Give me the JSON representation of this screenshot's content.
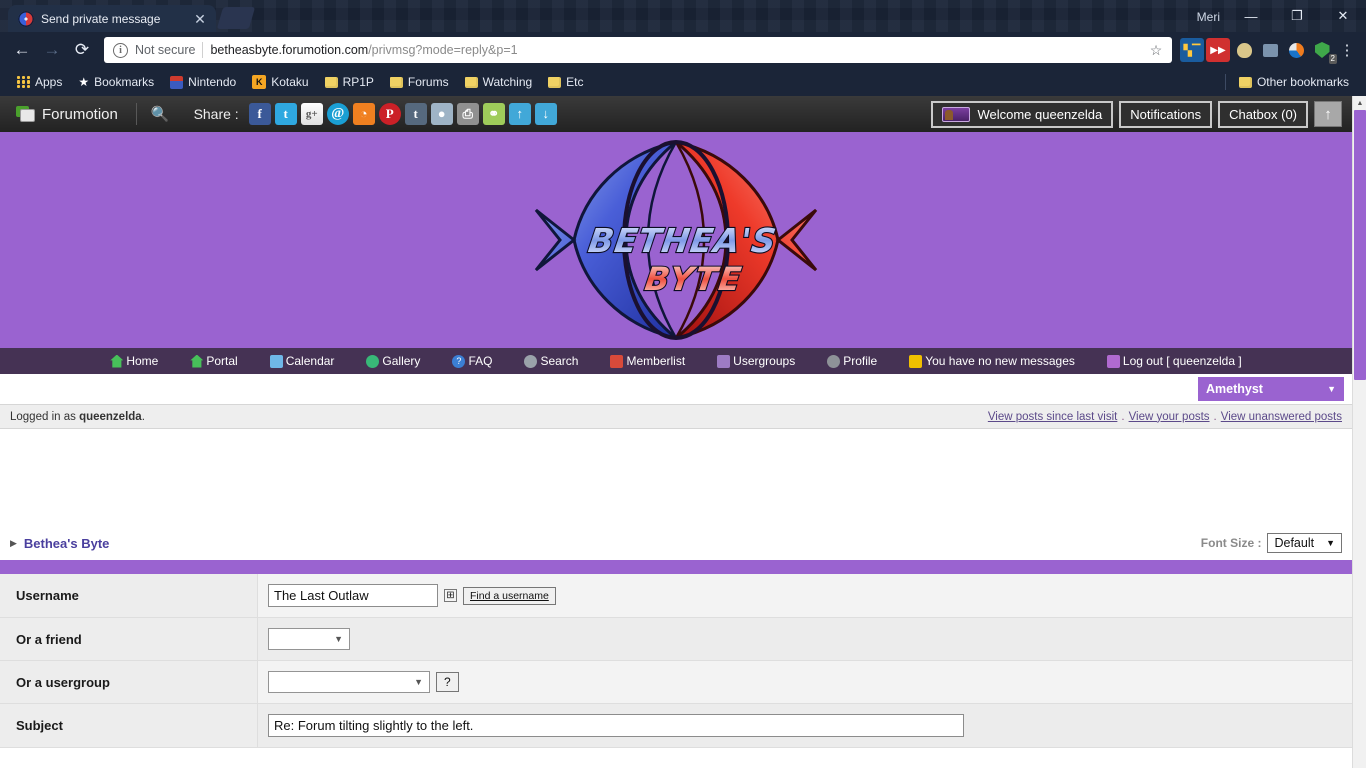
{
  "browser": {
    "tab_title": "Send private message",
    "tab_close": "✕",
    "profile_name": "Meri",
    "minimize": "—",
    "maximize": "❐",
    "close": "✕",
    "back": "←",
    "forward": "→",
    "reload": "⟳",
    "security_label": "Not secure",
    "url_domain": "betheasbyte.forumotion.com",
    "url_path": "/privmsg?mode=reply&p=1",
    "star": "☆",
    "menu": "⋮",
    "extension_badge": "2",
    "bookmarks": [
      {
        "label": "Apps",
        "icon": "apps-grid-icon"
      },
      {
        "label": "Bookmarks",
        "icon": "star-icon"
      },
      {
        "label": "Nintendo",
        "icon": "mario-icon"
      },
      {
        "label": "Kotaku",
        "icon": "kotaku-icon"
      },
      {
        "label": "RP1P",
        "icon": "folder-icon"
      },
      {
        "label": "Forums",
        "icon": "folder-icon"
      },
      {
        "label": "Watching",
        "icon": "folder-icon"
      },
      {
        "label": "Etc",
        "icon": "folder-icon"
      }
    ],
    "other_bookmarks": "Other bookmarks"
  },
  "forumotion_bar": {
    "brand": "Forumotion",
    "search_icon": "search-icon",
    "share_label": "Share :",
    "share_icons": [
      {
        "name": "facebook-icon",
        "glyph": "f"
      },
      {
        "name": "twitter-icon",
        "glyph": "t"
      },
      {
        "name": "googleplus-icon",
        "glyph": "g+"
      },
      {
        "name": "email-icon",
        "glyph": "@"
      },
      {
        "name": "rss-icon",
        "glyph": "◔"
      },
      {
        "name": "pinterest-icon",
        "glyph": "P"
      },
      {
        "name": "tumblr-icon",
        "glyph": "t"
      },
      {
        "name": "reddit-icon",
        "glyph": "●"
      },
      {
        "name": "print-icon",
        "glyph": "⎙"
      },
      {
        "name": "link-icon",
        "glyph": "⚭"
      },
      {
        "name": "arrow-up-icon",
        "glyph": "↑"
      },
      {
        "name": "arrow-down-icon",
        "glyph": "↓"
      }
    ],
    "welcome": "Welcome queenzelda",
    "notifications": "Notifications",
    "chatbox": "Chatbox (0)",
    "scroll_top_icon": "↑"
  },
  "banner": {
    "logo_line1": "BETHEA'S",
    "logo_line2": "BYTE",
    "background_color": "#9a63d0"
  },
  "forum_nav": [
    {
      "label": "Home",
      "icon": "home-icon",
      "cls": "i-home"
    },
    {
      "label": "Portal",
      "icon": "portal-icon",
      "cls": "i-home"
    },
    {
      "label": "Calendar",
      "icon": "calendar-icon",
      "cls": "i-cal"
    },
    {
      "label": "Gallery",
      "icon": "gallery-icon",
      "cls": "i-gal"
    },
    {
      "label": "FAQ",
      "icon": "faq-icon",
      "cls": "i-faq"
    },
    {
      "label": "Search",
      "icon": "search-icon",
      "cls": "i-sea"
    },
    {
      "label": "Memberlist",
      "icon": "memberlist-icon",
      "cls": "i-mem"
    },
    {
      "label": "Usergroups",
      "icon": "usergroups-icon",
      "cls": "i-usg"
    },
    {
      "label": "Profile",
      "icon": "profile-icon",
      "cls": "i-pro"
    },
    {
      "label": "You have no new messages",
      "icon": "envelope-icon",
      "cls": "i-msg"
    },
    {
      "label": "Log out [ queenzelda ]",
      "icon": "logout-icon",
      "cls": "i-out"
    }
  ],
  "theme": {
    "selected": "Amethyst",
    "caret": "▼"
  },
  "login_strip": {
    "prefix": "Logged in as ",
    "username": "queenzelda",
    "suffix": ".",
    "links": [
      "View posts since last visit",
      "View your posts",
      "View unanswered posts"
    ],
    "separator": "."
  },
  "breadcrumb": {
    "arrow": "▶",
    "label": "Bethea's Byte"
  },
  "font_size": {
    "label": "Font Size :",
    "selected": "Default",
    "caret": "▼"
  },
  "form": {
    "rows": [
      {
        "label": "Username",
        "type": "text",
        "value": "The Last Outlaw",
        "plus": "⊞",
        "button": "Find a username"
      },
      {
        "label": "Or a friend",
        "type": "select",
        "value": "",
        "caret": "▼"
      },
      {
        "label": "Or a usergroup",
        "type": "select_help",
        "value": "",
        "caret": "▼",
        "help": "?"
      },
      {
        "label": "Subject",
        "type": "text_wide",
        "value": "Re: Forum tilting slightly to the left."
      }
    ]
  },
  "scrollbar": {
    "up": "▲",
    "down": "▼"
  }
}
